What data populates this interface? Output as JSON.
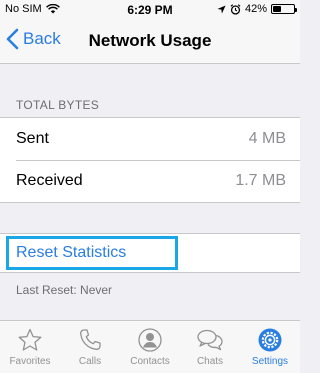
{
  "status_bar": {
    "carrier": "No SIM",
    "time": "6:29 PM",
    "battery_percent": "42%",
    "battery_level": 0.42
  },
  "nav": {
    "back_label": "Back",
    "title": "Network Usage"
  },
  "total_bytes": {
    "header": "TOTAL BYTES",
    "rows": [
      {
        "label": "Sent",
        "value": "4 MB"
      },
      {
        "label": "Received",
        "value": "1.7 MB"
      }
    ]
  },
  "reset": {
    "button_label": "Reset Statistics",
    "last_reset": "Last Reset: Never"
  },
  "tabs": [
    {
      "label": "Favorites",
      "icon": "star-icon"
    },
    {
      "label": "Calls",
      "icon": "phone-icon"
    },
    {
      "label": "Contacts",
      "icon": "contact-icon"
    },
    {
      "label": "Chats",
      "icon": "chat-bubbles-icon"
    },
    {
      "label": "Settings",
      "icon": "gear-icon",
      "active": true
    }
  ],
  "colors": {
    "accent": "#2a7de1",
    "highlight_border": "#1aa7e5",
    "background": "#efeff4",
    "inactive_tab": "#929292"
  }
}
